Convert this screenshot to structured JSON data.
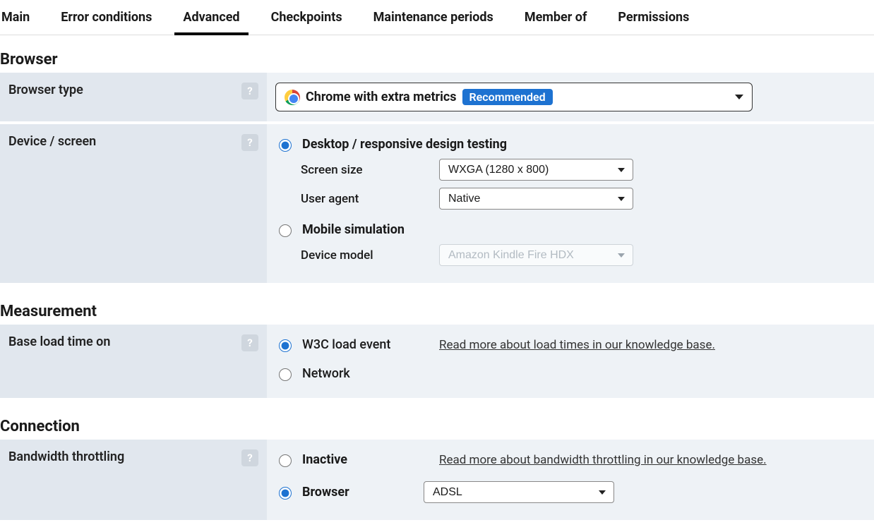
{
  "tabs": [
    "Main",
    "Error conditions",
    "Advanced",
    "Checkpoints",
    "Maintenance periods",
    "Member of",
    "Permissions"
  ],
  "active_tab_index": 2,
  "sections": {
    "browser": {
      "title": "Browser",
      "type_label": "Browser type",
      "dropdown_text": "Chrome with extra metrics",
      "badge": "Recommended",
      "device_label": "Device / screen",
      "desktop_option": "Desktop / responsive design testing",
      "screen_size_label": "Screen size",
      "screen_size_value": "WXGA (1280 x 800)",
      "user_agent_label": "User agent",
      "user_agent_value": "Native",
      "mobile_option": "Mobile simulation",
      "device_model_label": "Device model",
      "device_model_value": "Amazon Kindle Fire HDX"
    },
    "measurement": {
      "title": "Measurement",
      "base_label": "Base load time on",
      "w3c_option": "W3C load event",
      "network_option": "Network",
      "link": "Read more about load times in our knowledge base."
    },
    "connection": {
      "title": "Connection",
      "bandwidth_label": "Bandwidth throttling",
      "inactive_option": "Inactive",
      "browser_option": "Browser",
      "browser_value": "ADSL",
      "link": "Read more about bandwidth throttling in our knowledge base."
    }
  }
}
